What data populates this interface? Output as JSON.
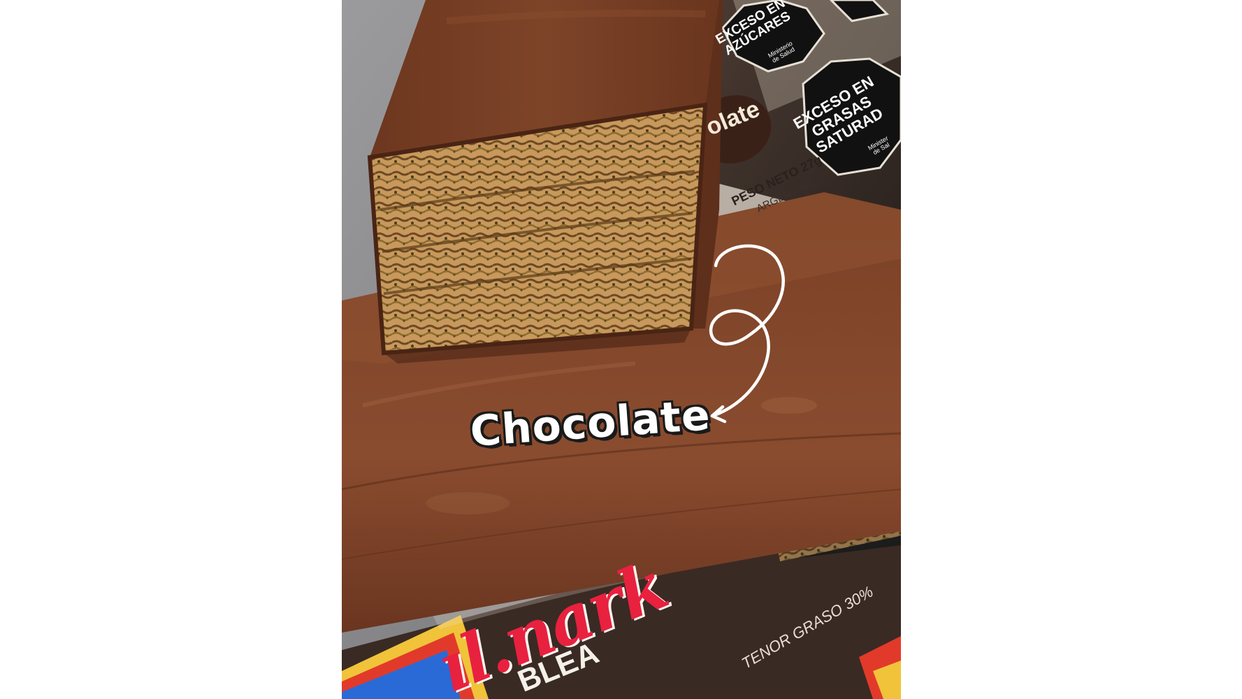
{
  "overlay": {
    "caption": "Chocolate"
  },
  "package_top": {
    "warning_1": "EXCESO EN\nAZÚCARES",
    "warning_1_issuer": "Ministerio\nde Salud",
    "warning_2": "EXCESO EN\nGRASAS\nSATURAD",
    "warning_2_issuer": "Minister\nde Sal",
    "flavor_partial": "olate",
    "net_weight": "PESO NETO 27g",
    "origin": "ARGENTINA"
  },
  "package_bottom": {
    "brand_partial": "ıl.nark",
    "product_partial": "BLEA",
    "fat_content": "TENOR GRASO 30%"
  },
  "colors": {
    "chocolate_dark": "#5a2e1d",
    "chocolate_mid": "#7b4128",
    "chocolate_light": "#9a5a3a",
    "wafer": "#c79a60",
    "background_gray": "#8a8a8c",
    "warning_octagon": "#111111",
    "brand_red": "#e8213f"
  },
  "icons": {
    "arrow": "curly-arrow-icon"
  }
}
